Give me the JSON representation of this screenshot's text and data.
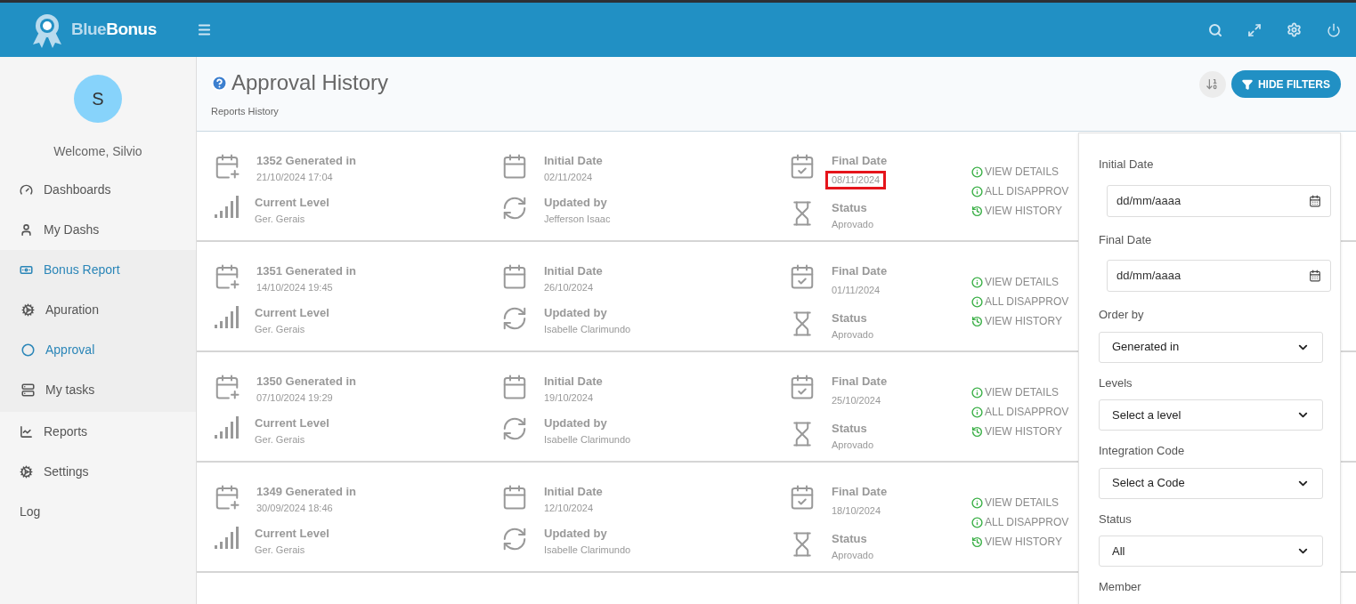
{
  "header": {
    "logo": {
      "first": "Blue",
      "second": "Bonus"
    }
  },
  "sidebar": {
    "avatar": "S",
    "welcome": "Welcome, Silvio",
    "items": [
      {
        "label": "Dashboards",
        "selected": false
      },
      {
        "label": "My Dashs",
        "selected": false
      },
      {
        "label": "Bonus Report",
        "selected": true,
        "expanded": true,
        "children": [
          {
            "label": "Apuration",
            "selected": false
          },
          {
            "label": "Approval",
            "selected": true
          },
          {
            "label": "My tasks",
            "selected": false
          }
        ]
      },
      {
        "label": "Reports",
        "selected": false
      },
      {
        "label": "Settings",
        "selected": false
      },
      {
        "label": "Log",
        "selected": false
      }
    ]
  },
  "page": {
    "title": "Approval History",
    "subtitle": "Reports History",
    "filter_button": "HIDE FILTERS"
  },
  "reports": [
    {
      "generated": "1352 Generated in",
      "generated_at": "21/10/2024 17:04",
      "initial_label": "Initial Date",
      "initial": "02/11/2024",
      "final_label": "Final Date",
      "final": "08/11/2024",
      "highlighted": true,
      "level_label": "Current Level",
      "level": "Ger. Gerais",
      "updated_label": "Updated by",
      "updated_by": "Jefferson Isaac",
      "status_label": "Status",
      "status": "Aprovado",
      "actions": [
        "VIEW DETAILS",
        "ALL DISAPPROV",
        "VIEW HISTORY"
      ]
    },
    {
      "generated": "1351 Generated in",
      "generated_at": "14/10/2024 19:45",
      "initial_label": "Initial Date",
      "initial": "26/10/2024",
      "final_label": "Final Date",
      "final": "01/11/2024",
      "highlighted": false,
      "level_label": "Current Level",
      "level": "Ger. Gerais",
      "updated_label": "Updated by",
      "updated_by": "Isabelle Clarimundo",
      "status_label": "Status",
      "status": "Aprovado",
      "actions": [
        "VIEW DETAILS",
        "ALL DISAPPROV",
        "VIEW HISTORY"
      ]
    },
    {
      "generated": "1350 Generated in",
      "generated_at": "07/10/2024 19:29",
      "initial_label": "Initial Date",
      "initial": "19/10/2024",
      "final_label": "Final Date",
      "final": "25/10/2024",
      "highlighted": false,
      "level_label": "Current Level",
      "level": "Ger. Gerais",
      "updated_label": "Updated by",
      "updated_by": "Isabelle Clarimundo",
      "status_label": "Status",
      "status": "Aprovado",
      "actions": [
        "VIEW DETAILS",
        "ALL DISAPPROV",
        "VIEW HISTORY"
      ]
    },
    {
      "generated": "1349 Generated in",
      "generated_at": "30/09/2024 18:46",
      "initial_label": "Initial Date",
      "initial": "12/10/2024",
      "final_label": "Final Date",
      "final": "18/10/2024",
      "highlighted": false,
      "level_label": "Current Level",
      "level": "Ger. Gerais",
      "updated_label": "Updated by",
      "updated_by": "Isabelle Clarimundo",
      "status_label": "Status",
      "status": "Aprovado",
      "actions": [
        "VIEW DETAILS",
        "ALL DISAPPROV",
        "VIEW HISTORY"
      ]
    }
  ],
  "filters": [
    {
      "kind": "date",
      "label": "Initial Date",
      "placeholder": "dd/mm/aaaa"
    },
    {
      "kind": "date",
      "label": "Final Date",
      "placeholder": "dd/mm/aaaa"
    },
    {
      "kind": "select",
      "label": "Order by",
      "value": "Generated in"
    },
    {
      "kind": "select",
      "label": "Levels",
      "value": "Select a level"
    },
    {
      "kind": "select",
      "label": "Integration Code",
      "value": "Select a Code"
    },
    {
      "kind": "select",
      "label": "Status",
      "value": "All"
    },
    {
      "kind": "label",
      "label": "Member"
    }
  ]
}
